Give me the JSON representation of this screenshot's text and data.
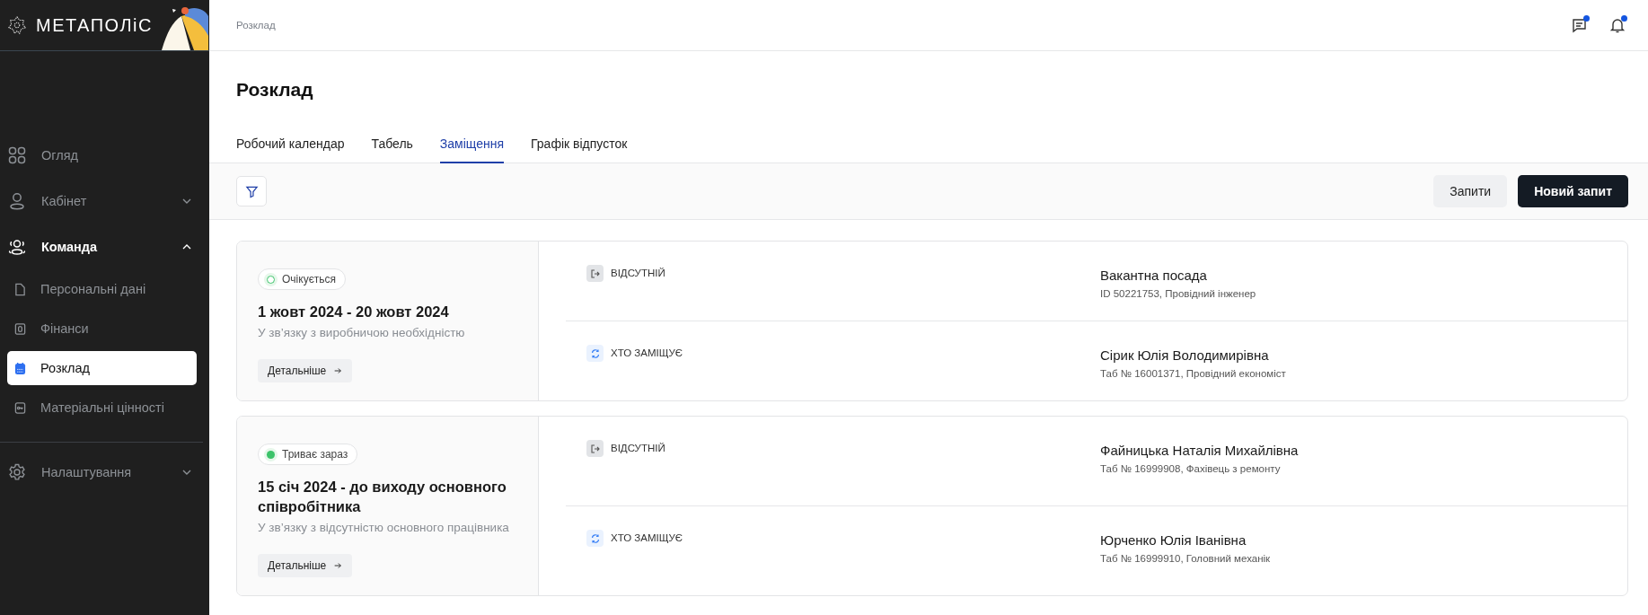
{
  "logo": {
    "text": "МЕТАПОЛіС"
  },
  "sidebar": {
    "items": [
      {
        "label": "Огляд",
        "selected": false
      },
      {
        "label": "Кабінет",
        "selected": false,
        "expanded": false
      },
      {
        "label": "Команда",
        "selected": false,
        "expanded": true,
        "children": [
          {
            "label": "Персональні дані",
            "selected": false
          },
          {
            "label": "Фінанси",
            "selected": false
          },
          {
            "label": "Розклад",
            "selected": true
          },
          {
            "label": "Матеріальні цінності",
            "selected": false
          }
        ]
      },
      {
        "label": "Налаштування",
        "selected": false,
        "expanded": false,
        "divider_before": true
      }
    ]
  },
  "header": {
    "breadcrumb": "Розклад",
    "icons": [
      {
        "unread": true
      },
      {
        "unread": true
      }
    ]
  },
  "page": {
    "title": "Розклад"
  },
  "tabs": [
    {
      "label": "Робочий календар",
      "selected": false
    },
    {
      "label": "Табель",
      "selected": false
    },
    {
      "label": "Заміщення",
      "selected": true
    },
    {
      "label": "Графік відпусток",
      "selected": false
    }
  ],
  "toolbar": {
    "buttons": [
      {
        "label": "Запити",
        "kind": "secondary"
      },
      {
        "label": "Новий запит",
        "kind": "primary"
      }
    ]
  },
  "cards": [
    {
      "status": {
        "label": "Очікується",
        "kind": "pending"
      },
      "period": "1 жовт 2024 - 20 жовт 2024",
      "reason": "У зв’язку з виробничою необхідністю",
      "details": "Детальніше",
      "roles": [
        {
          "kind": "absent",
          "label": "ВІДСУТНІЙ",
          "name": "Вакантна посада",
          "info": "ID 50221753, Провідний інженер"
        },
        {
          "kind": "substitute",
          "label": "ХТО ЗАМІЩУЄ",
          "name": "Сірик Юлія Володимирівна",
          "info": "Таб № 16001371, Провідний економіст"
        }
      ]
    },
    {
      "status": {
        "label": "Триває зараз",
        "kind": "ongoing"
      },
      "period": "15 січ 2024 - до виходу основного співробітника",
      "reason": "У зв’язку з відсутністю основного працівника",
      "details": "Детальніше",
      "roles": [
        {
          "kind": "absent",
          "label": "ВІДСУТНІЙ",
          "name": "Файницька Наталія Михайлівна",
          "info": "Таб № 16999908, Фахівець з ремонту"
        },
        {
          "kind": "substitute",
          "label": "ХТО ЗАМІЩУЄ",
          "name": "Юрченко Юлія Іванівна",
          "info": "Таб № 16999910, Головний механік"
        }
      ]
    }
  ]
}
